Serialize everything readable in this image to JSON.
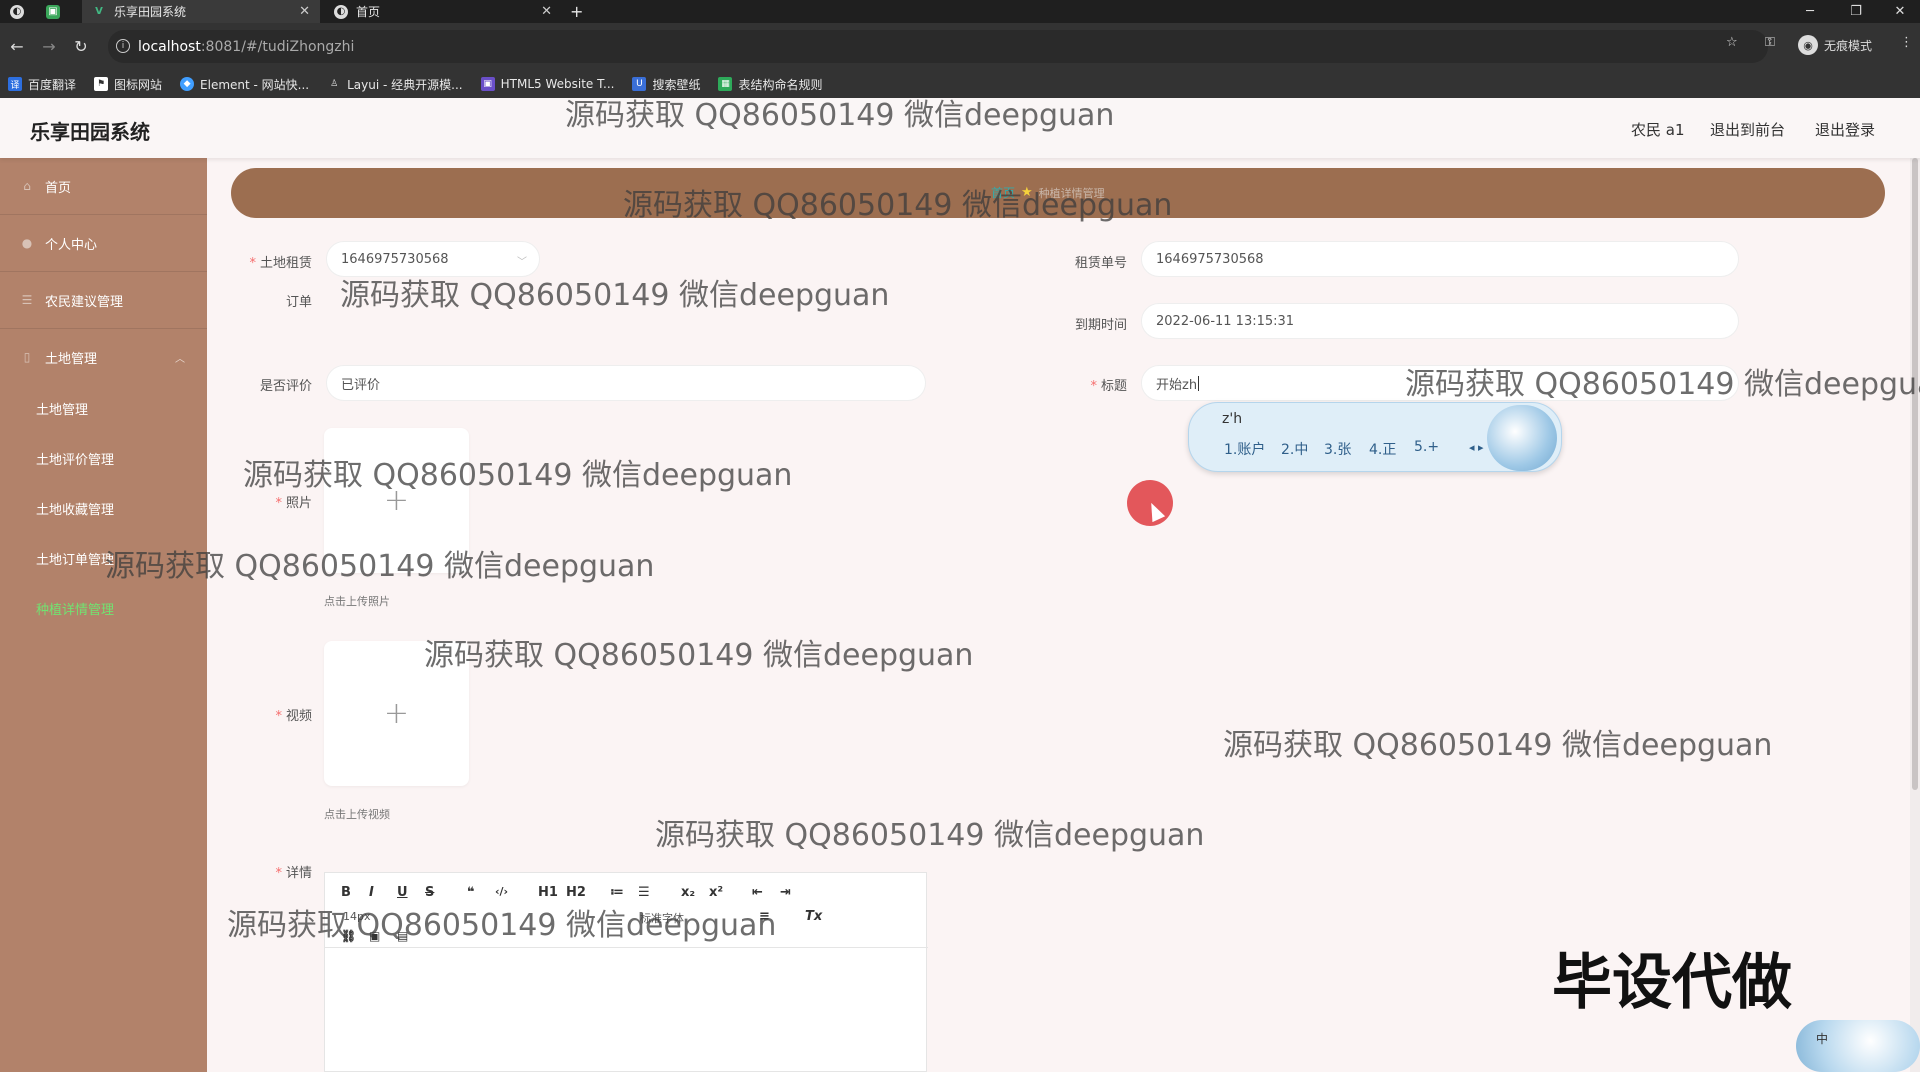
{
  "browser": {
    "tabs": [
      {
        "title": "乐享田园系统",
        "active": true
      },
      {
        "title": "首页",
        "active": false
      }
    ],
    "new_tab": "+",
    "url": "localhost:8081/#/tudiZhongzhi",
    "url_host": "localhost",
    "url_rest": ":8081/#/tudiZhongzhi",
    "incognito_label": "无痕模式",
    "bookmarks": [
      "百度翻译",
      "图标网站",
      "Element - 网站快...",
      "Layui - 经典开源模...",
      "HTML5 Website T...",
      "搜索壁纸",
      "表结构命名规则"
    ]
  },
  "app": {
    "title": "乐享田园系统",
    "header_links": [
      "农民 a1",
      "退出到前台",
      "退出登录"
    ]
  },
  "sidebar": {
    "items": [
      {
        "label": "首页"
      },
      {
        "label": "个人中心"
      },
      {
        "label": "农民建议管理"
      },
      {
        "label": "土地管理"
      }
    ],
    "sub_items": [
      {
        "label": "土地管理",
        "active": false
      },
      {
        "label": "土地评价管理",
        "active": false
      },
      {
        "label": "土地收藏管理",
        "active": false
      },
      {
        "label": "土地订单管理",
        "active": false
      },
      {
        "label": "种植详情管理",
        "active": true
      }
    ]
  },
  "breadcrumb": {
    "home": "首页",
    "current": "种植详情管理"
  },
  "form": {
    "land_label": "土地租赁",
    "land_label_line2": "订单",
    "land_value": "1646975730568",
    "rent_no_label": "租赁单号",
    "rent_no_value": "1646975730568",
    "expire_label": "到期时间",
    "expire_value": "2022-06-11 13:15:31",
    "evaluated_label": "是否评价",
    "evaluated_value": "已评价",
    "title_label": "标题",
    "title_value": "开始zh",
    "photo_label": "照片",
    "photo_tip": "点击上传照片",
    "video_label": "视频",
    "video_tip": "点击上传视频",
    "detail_label": "详情",
    "upload_plus": "+"
  },
  "editor": {
    "toolbar_row1": [
      "B",
      "I",
      "U",
      "S",
      "❝",
      "‹/›",
      "H1",
      "H2",
      "≔",
      "☰",
      "x₂",
      "x²",
      "⇤",
      "⇥"
    ],
    "font_size": "14px",
    "font_family": "标准字体",
    "clear": "Tx"
  },
  "ime": {
    "composition": "z'h",
    "candidates": [
      "1.账户",
      "2.中",
      "3.张",
      "4.正",
      "5.+"
    ],
    "status": "中"
  },
  "watermark": "源码获取 QQ86050149 微信deepguan",
  "overlay_text": "毕设代做"
}
